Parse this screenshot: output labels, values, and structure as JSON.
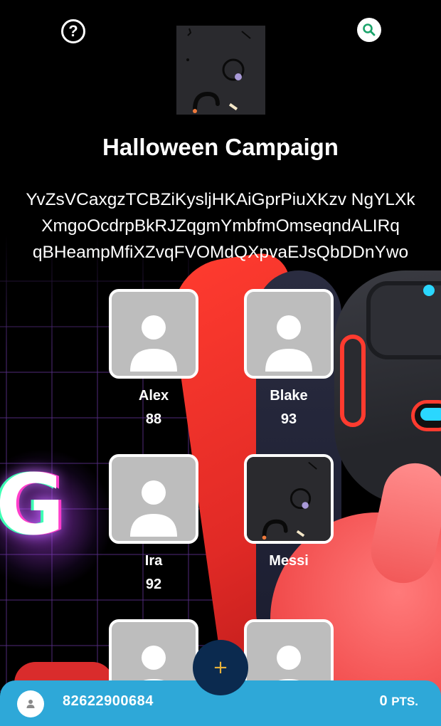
{
  "header": {
    "help_icon": "help-circle-icon",
    "search_icon": "search-icon",
    "logo_icon": "campaign-logo"
  },
  "campaign": {
    "title": "Halloween Campaign",
    "description_lines": [
      "YvZsVCaxgzTCBZiKysljHKAiGprPiuXKzv NgYLXk",
      "XmgoOcdrpBkRJZqgmYmbfmOmseqndALIRq",
      "qBHeampMfiXZvqFVOMdQXpvaEJsQbDDnYwo"
    ]
  },
  "players": [
    {
      "name": "Alex",
      "score": "88",
      "avatar": "user-placeholder-icon"
    },
    {
      "name": "Blake",
      "score": "93",
      "avatar": "user-placeholder-icon"
    },
    {
      "name": "Ira",
      "score": "92",
      "avatar": "user-placeholder-icon"
    },
    {
      "name": "Messi",
      "score": "",
      "avatar": "campaign-logo"
    },
    {
      "name": "",
      "score": "",
      "avatar": "user-placeholder-icon"
    },
    {
      "name": "",
      "score": "",
      "avatar": "user-placeholder-icon"
    }
  ],
  "fab": {
    "label": "+"
  },
  "footer": {
    "user_id": "82622900684",
    "points_value": "0",
    "points_unit": "PTS.",
    "avatar_icon": "user-icon"
  },
  "colors": {
    "bottom_bar": "#2ea8d8",
    "fab_bg": "#0b2a4f",
    "fab_icon": "#e8b23a",
    "search_icon": "#1aa36a"
  }
}
